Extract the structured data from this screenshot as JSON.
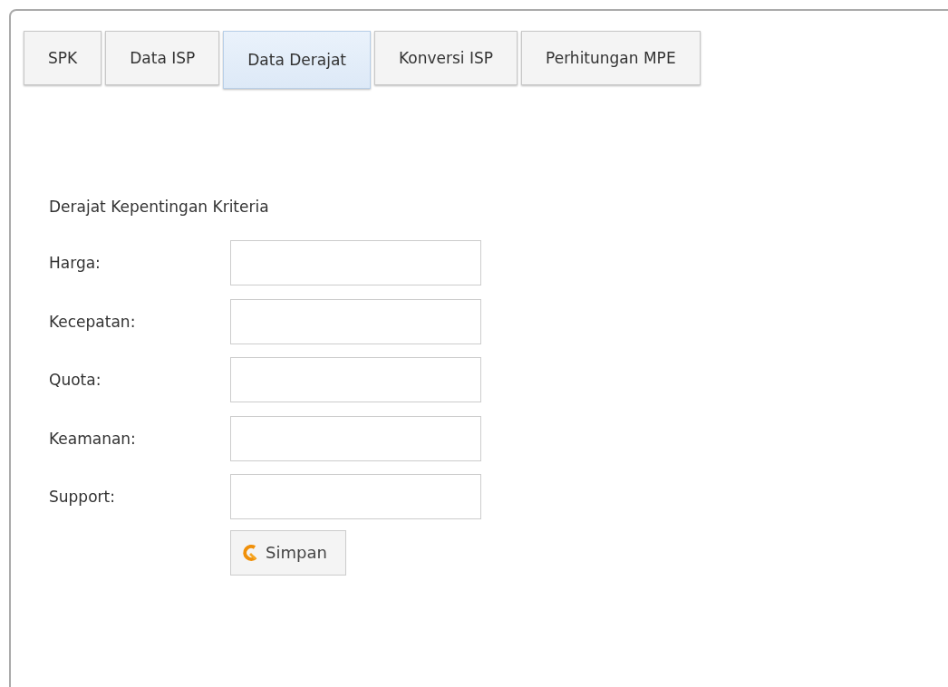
{
  "tabs": [
    {
      "label": "SPK",
      "selected": false
    },
    {
      "label": "Data ISP",
      "selected": false
    },
    {
      "label": "Data Derajat",
      "selected": true
    },
    {
      "label": "Konversi ISP",
      "selected": false
    },
    {
      "label": "Perhitungan MPE",
      "selected": false
    }
  ],
  "form": {
    "title": "Derajat Kepentingan Kriteria",
    "fields": [
      {
        "label": "Harga:"
      },
      {
        "label": "Kecepatan:"
      },
      {
        "label": "Quota:"
      },
      {
        "label": "Keamanan:"
      },
      {
        "label": "Support:"
      }
    ],
    "button": "Simpan"
  }
}
